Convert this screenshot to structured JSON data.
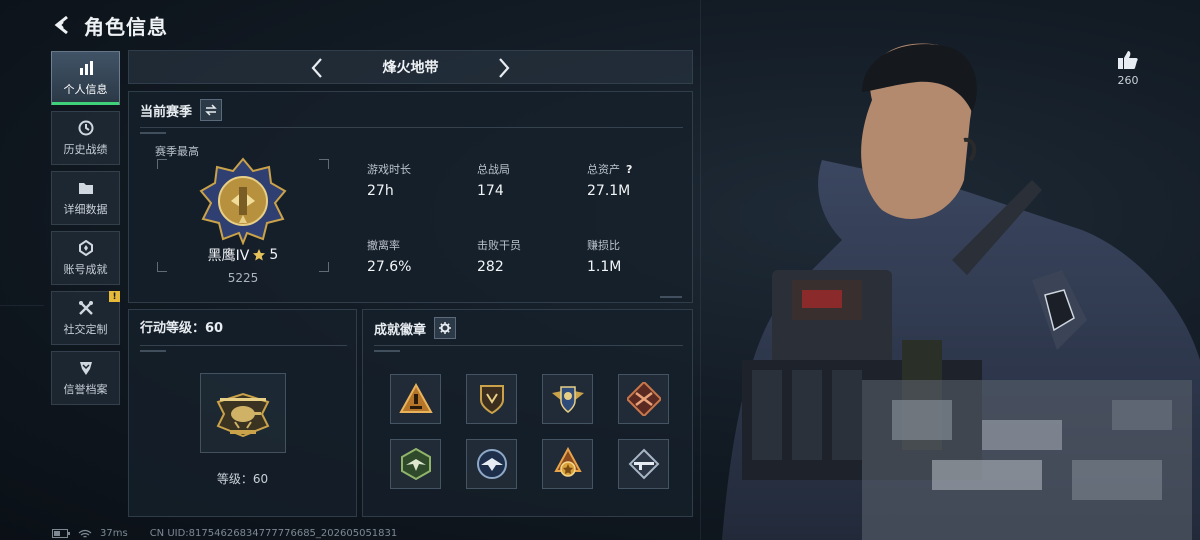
{
  "header": {
    "title": "角色信息"
  },
  "tabs": [
    {
      "label": "个人信息",
      "icon": "bar-chart-icon",
      "active": true
    },
    {
      "label": "历史战绩",
      "icon": "clock-icon"
    },
    {
      "label": "详细数据",
      "icon": "folder-icon"
    },
    {
      "label": "账号成就",
      "icon": "achievement-icon"
    },
    {
      "label": "社交定制",
      "icon": "tools-icon",
      "badge": "!"
    },
    {
      "label": "信誉档案",
      "icon": "credit-shield-icon"
    }
  ],
  "mode": {
    "label": "烽火地带"
  },
  "season": {
    "title": "当前赛季",
    "best_label": "赛季最高",
    "rank_name": "黑鹰IV",
    "rank_stars": "5",
    "rank_score": "5225",
    "stats": [
      {
        "label": "游戏时长",
        "value": "27h"
      },
      {
        "label": "总战局",
        "value": "174"
      },
      {
        "label": "总资产",
        "value": "27.1M",
        "help": "?"
      },
      {
        "label": "撤离率",
        "value": "27.6%"
      },
      {
        "label": "击败干员",
        "value": "282"
      },
      {
        "label": "赚损比",
        "value": "1.1M"
      }
    ]
  },
  "level": {
    "title": "行动等级：60",
    "level_text": "等级：60"
  },
  "achievements": {
    "title": "成就徽章",
    "badges": [
      "warning-triangle-badge",
      "shield-badge",
      "wings-shield-badge",
      "crossed-arms-badge",
      "eagle-badge",
      "round-eagle-badge",
      "medal-badge",
      "rifle-badge"
    ]
  },
  "like": {
    "count": "260"
  },
  "status": {
    "ping": "37ms",
    "uid": "CN UID:81754626834777776685_202605051831"
  },
  "colors": {
    "accent": "#3fd27a",
    "badge_warning": "#e6b93a",
    "gold": "#c9a24a"
  }
}
